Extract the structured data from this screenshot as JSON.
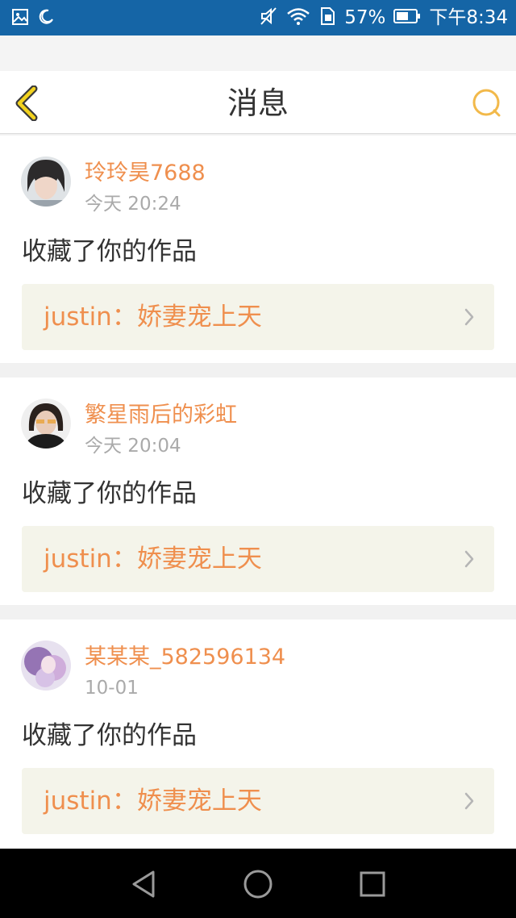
{
  "status_bar": {
    "battery_percent": "57%",
    "time": "下午8:34",
    "icons": [
      "gallery-icon",
      "moon-icon",
      "mute-icon",
      "wifi-icon",
      "sim-icon",
      "battery-icon"
    ]
  },
  "header": {
    "title": "消息",
    "back_icon": "chevron-left-icon",
    "search_icon": "search-icon",
    "accent_color": "#f2b94a"
  },
  "messages": [
    {
      "username": "玲玲昊7688",
      "time": "今天 20:24",
      "action": "收藏了你的作品",
      "work": "justin：娇妻宠上天"
    },
    {
      "username": "繁星雨后的彩虹",
      "time": "今天 20:04",
      "action": "收藏了你的作品",
      "work": "justin：娇妻宠上天"
    },
    {
      "username": "某某某_582596134",
      "time": "10-01",
      "action": "收藏了你的作品",
      "work": "justin：娇妻宠上天"
    }
  ],
  "nav_bar": {
    "icons": [
      "back-triangle-icon",
      "home-circle-icon",
      "recents-square-icon"
    ]
  },
  "colors": {
    "status_bar": "#1565a6",
    "username": "#ef8f4e",
    "work_box_bg": "#f4f4ea"
  }
}
